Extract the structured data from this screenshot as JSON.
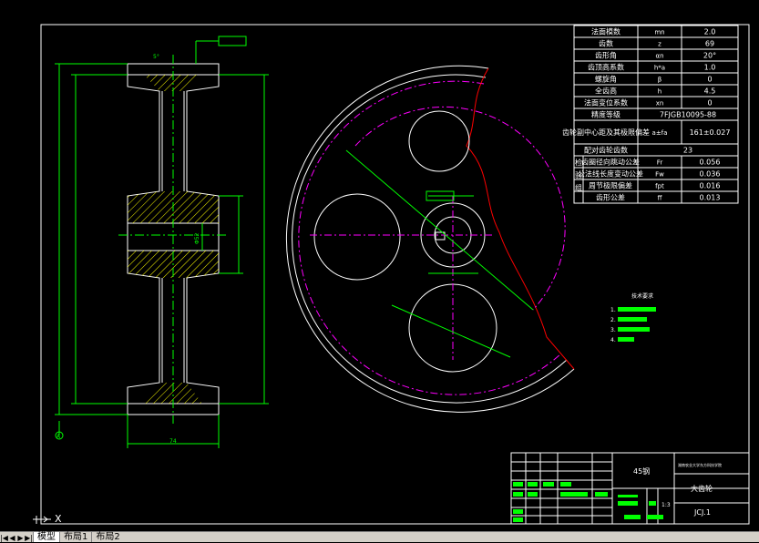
{
  "colors": {
    "background": "#000000",
    "white": "#ffffff",
    "green": "#00ff00",
    "yellow": "#ffff00",
    "magenta": "#ff00ff",
    "red": "#ff0000",
    "cyan": "#00ffff"
  },
  "param_table": [
    {
      "name": "法面模数",
      "symbol": "mn",
      "value": "2.0"
    },
    {
      "name": "齿数",
      "symbol": "z",
      "value": "69"
    },
    {
      "name": "齿形角",
      "symbol": "αn",
      "value": "20°"
    },
    {
      "name": "齿顶高系数",
      "symbol": "h*a",
      "value": "1.0"
    },
    {
      "name": "螺旋角",
      "symbol": "β",
      "value": "0"
    },
    {
      "name": "全齿高",
      "symbol": "h",
      "value": "4.5"
    },
    {
      "name": "法面变位系数",
      "symbol": "xn",
      "value": "0"
    },
    {
      "name": "精度等级",
      "symbol": "",
      "value": "7FJGB10095-88"
    },
    {
      "name": "齿轮副中心距及其极限偏差",
      "symbol": "a±fa",
      "value": "161±0.027"
    },
    {
      "name": "配对齿轮齿数",
      "symbol": "",
      "value": "23"
    },
    {
      "name": "齿圈径向跳动公差",
      "symbol": "Fr",
      "value": "0.056"
    },
    {
      "name": "公法线长度变动公差",
      "symbol": "Fw",
      "value": "0.036"
    },
    {
      "name": "周节极限偏差",
      "symbol": "fpt",
      "value": "0.016"
    },
    {
      "name": "齿形公差",
      "symbol": "ff",
      "value": "0.013"
    }
  ],
  "group_label": "检验组",
  "title_block": {
    "material": "45钢",
    "school": "湖南农业大学东方科技学院",
    "part_name": "大齿轮",
    "drawing_no": "JCJ.1",
    "scale": "1:3"
  },
  "tech_notes": {
    "title": "技术要求",
    "items": [
      "1.",
      "2.",
      "3.",
      "4."
    ]
  },
  "dims": {
    "width": "74",
    "bore": "Φ52",
    "top_angle": "5°",
    "datum": "A"
  },
  "tabs": [
    "模型",
    "布局1",
    "布局2"
  ]
}
